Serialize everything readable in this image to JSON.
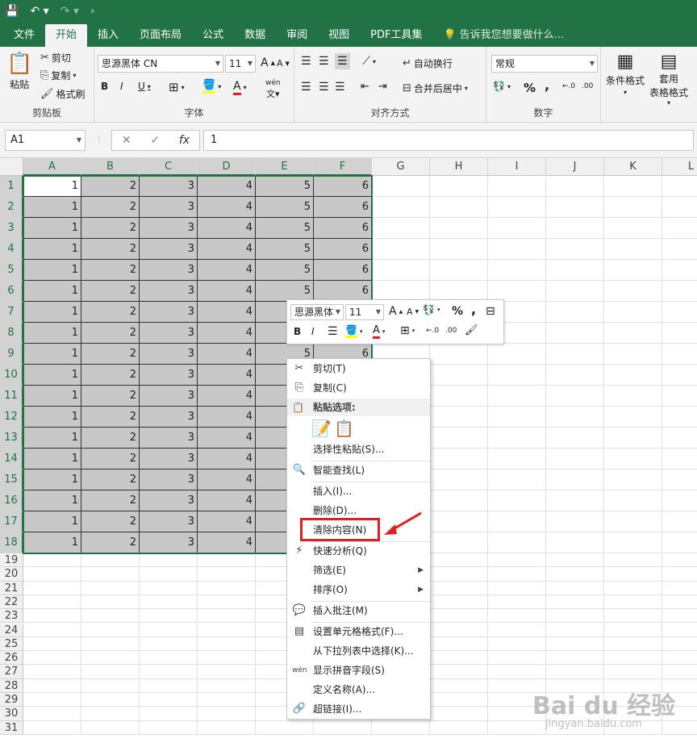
{
  "quick_access": {
    "save_icon": "save-icon",
    "undo_icon": "undo-icon",
    "redo_icon": "redo-icon",
    "customize_icon": "customize-icon"
  },
  "tabs": [
    {
      "label": "文件"
    },
    {
      "label": "开始"
    },
    {
      "label": "插入"
    },
    {
      "label": "页面布局"
    },
    {
      "label": "公式"
    },
    {
      "label": "数据"
    },
    {
      "label": "审阅"
    },
    {
      "label": "视图"
    },
    {
      "label": "PDF工具集"
    }
  ],
  "tell_me": "告诉我您想要做什么...",
  "ribbon": {
    "clipboard": {
      "paste": "粘贴",
      "cut": "剪切",
      "copy": "复制",
      "format_painter": "格式刷",
      "label": "剪贴板"
    },
    "font": {
      "name": "思源黑体 CN",
      "size": "11",
      "label": "字体",
      "bold": "B",
      "italic": "I",
      "underline": "U",
      "font_color": "A",
      "grow": "A",
      "shrink": "A",
      "wen": "wén"
    },
    "alignment": {
      "wrap": "自动换行",
      "merge": "合并后居中",
      "label": "对齐方式"
    },
    "number": {
      "format": "常规",
      "percent": "%",
      "comma": ",",
      "label": "数字"
    },
    "styles": {
      "conditional": "条件格式",
      "table_format_1": "套用",
      "table_format_2": "表格格式"
    }
  },
  "formula_bar": {
    "name_box": "A1",
    "cancel": "✕",
    "enter": "✓",
    "fx": "fx",
    "value": "1"
  },
  "sheet": {
    "columns": [
      "A",
      "B",
      "C",
      "D",
      "E",
      "F",
      "G",
      "H",
      "I",
      "J",
      "K",
      "L"
    ],
    "rows": [
      "1",
      "2",
      "3",
      "4",
      "5",
      "6",
      "7",
      "8",
      "9",
      "10",
      "11",
      "12",
      "13",
      "14",
      "15",
      "16",
      "17",
      "18",
      "19",
      "20",
      "21",
      "22",
      "23",
      "24",
      "25",
      "26",
      "27",
      "28",
      "29",
      "30",
      "31"
    ],
    "data_row": [
      "1",
      "2",
      "3",
      "4",
      "5",
      "6"
    ]
  },
  "mini_toolbar": {
    "font": "思源黑体",
    "size": "11",
    "bold": "B",
    "italic": "I",
    "percent": "%",
    "comma": ",",
    "font_color": "A",
    "grow": "A",
    "shrink": "A"
  },
  "context_menu": {
    "cut": "剪切(T)",
    "copy": "复制(C)",
    "paste_options": "粘贴选项:",
    "paste_special": "选择性粘贴(S)...",
    "smart_lookup": "智能查找(L)",
    "insert": "插入(I)...",
    "delete": "删除(D)...",
    "clear_contents": "清除内容(N)",
    "quick_analysis": "快速分析(Q)",
    "filter": "筛选(E)",
    "sort": "排序(O)",
    "insert_comment": "插入批注(M)",
    "format_cells": "设置单元格格式(F)...",
    "pick_from_list": "从下拉列表中选择(K)...",
    "phonetic": "显示拼音字段(S)",
    "define_name": "定义名称(A)...",
    "hyperlink": "超链接(I)..."
  },
  "watermark": {
    "brand": "Bai du 经验",
    "url": "jingyan.baidu.com"
  },
  "colors": {
    "excel_green": "#217346",
    "selection_gray": "#c8c8c8",
    "highlight_red": "#e0201e"
  }
}
